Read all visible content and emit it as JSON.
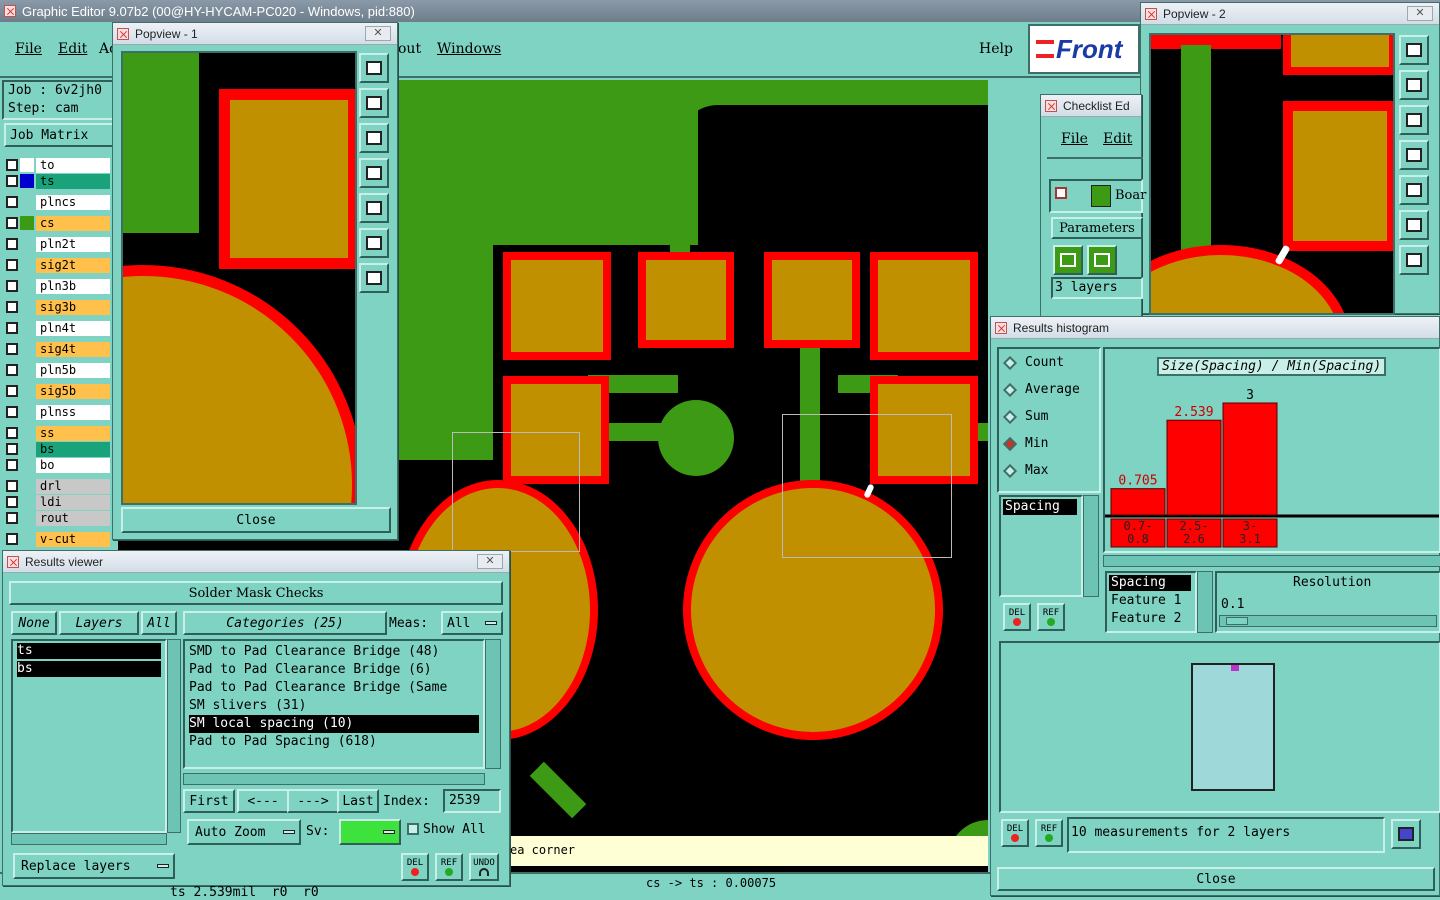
{
  "app": {
    "title": "Graphic Editor 9.07b2 (00@HY-HYCAM-PC020 - Windows, pid:880)"
  },
  "menu": {
    "file": "File",
    "edit": "Edit",
    "action": "Ac",
    "layout": "out",
    "windows": "Windows",
    "help": "Help",
    "brand": "Front"
  },
  "job": {
    "job": "Job : 6v2jh0",
    "step": "Step: cam",
    "matrix": "Job Matrix"
  },
  "layers": [
    {
      "name": "to",
      "color": "#ffffff",
      "fill": "#ffffff"
    },
    {
      "name": "ts",
      "color": "#0000cc",
      "fill": "#1aa37a"
    },
    {
      "name": "plncs",
      "color": "#7fd3c3",
      "fill": "#ffffff"
    },
    {
      "name": "cs",
      "color": "#3c9a14",
      "fill": "#ffc04c"
    },
    {
      "name": "pln2t",
      "color": "#7fd3c3",
      "fill": "#ffffff"
    },
    {
      "name": "sig2t",
      "color": "#7fd3c3",
      "fill": "#ffc04c"
    },
    {
      "name": "pln3b",
      "color": "#7fd3c3",
      "fill": "#ffffff"
    },
    {
      "name": "sig3b",
      "color": "#7fd3c3",
      "fill": "#ffc04c"
    },
    {
      "name": "pln4t",
      "color": "#7fd3c3",
      "fill": "#ffffff"
    },
    {
      "name": "sig4t",
      "color": "#7fd3c3",
      "fill": "#ffc04c"
    },
    {
      "name": "pln5b",
      "color": "#7fd3c3",
      "fill": "#ffffff"
    },
    {
      "name": "sig5b",
      "color": "#7fd3c3",
      "fill": "#ffc04c"
    },
    {
      "name": "plnss",
      "color": "#7fd3c3",
      "fill": "#ffffff"
    },
    {
      "name": "ss",
      "color": "#7fd3c3",
      "fill": "#ffc04c"
    },
    {
      "name": "bs",
      "color": "#7fd3c3",
      "fill": "#1aa37a"
    },
    {
      "name": "bo",
      "color": "#7fd3c3",
      "fill": "#ffffff"
    },
    {
      "name": "drl",
      "color": "#7fd3c3",
      "fill": "#c8c8c8"
    },
    {
      "name": "ldi",
      "color": "#7fd3c3",
      "fill": "#c8c8c8"
    },
    {
      "name": "rout",
      "color": "#7fd3c3",
      "fill": "#c8c8c8"
    },
    {
      "name": "v-cut",
      "color": "#7fd3c3",
      "fill": "#ffc04c"
    }
  ],
  "popview1": {
    "title": "Popview - 1",
    "close": "Close"
  },
  "popview2": {
    "title": "Popview - 2"
  },
  "checklist": {
    "title": "Checklist Ed",
    "file": "File",
    "edit": "Edit",
    "board": "Boar",
    "parameters": "Parameters",
    "layers": "3 layers"
  },
  "histogram": {
    "title": "Results histogram",
    "modes": [
      "Count",
      "Average",
      "Sum",
      "Min",
      "Max"
    ],
    "selected_mode": "Min",
    "list_item": "Spacing",
    "chart_title": "Size(Spacing) / Min(Spacing)",
    "bar_labels": [
      "0.705",
      "2.539",
      "3"
    ],
    "bin_labels": [
      "0.7-\n0.8",
      "2.5-\n2.6",
      "3-\n3.1"
    ],
    "resolution_label": "Resolution",
    "resolution_value": "0.1",
    "fields": [
      "Spacing",
      "Feature 1",
      "Feature 2"
    ],
    "summary": "10 measurements for 2 layers",
    "close": "Close",
    "del": "DEL",
    "ref": "REF"
  },
  "chart_data": {
    "type": "bar",
    "title": "Size(Spacing) / Min(Spacing)",
    "categories": [
      "0.7-0.8",
      "2.5-2.6",
      "3-3.1"
    ],
    "values": [
      0.705,
      2.539,
      3
    ],
    "ylim": [
      0,
      3
    ]
  },
  "results": {
    "title": "Results viewer",
    "header": "Solder Mask Checks",
    "none": "None",
    "layers": "Layers",
    "all": "All",
    "layer_items": [
      "ts",
      "bs"
    ],
    "categories": "Categories (25)",
    "meas_label": "Meas:",
    "meas_value": "All",
    "cat_items": [
      "SMD to Pad Clearance Bridge (48)",
      "Pad to Pad Clearance Bridge (6)",
      "Pad to Pad Clearance Bridge (Same",
      "SM slivers (31)",
      "SM local spacing (10)",
      "Pad to Pad Spacing (618)"
    ],
    "selected_index": 4,
    "first": "First",
    "prev": "<---",
    "next": "--->",
    "last": "Last",
    "index_label": "Index:",
    "index_value": "2539",
    "auto_zoom": "Auto Zoom",
    "sv": "Sv:",
    "show_all": "Show All",
    "replace": "Replace layers",
    "del": "DEL",
    "ref": "REF",
    "undo": "UNDO"
  },
  "status": {
    "left": "ts 2.539mil  r0  r0",
    "center": "cs -> ts : 0.00075",
    "hint": "ea corner"
  }
}
